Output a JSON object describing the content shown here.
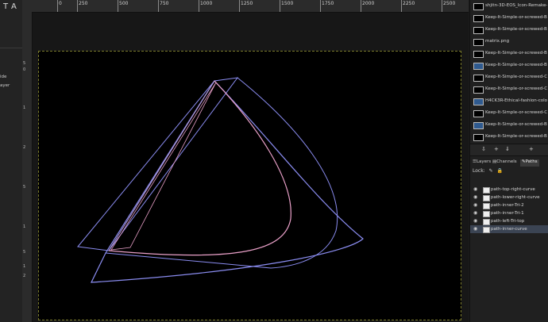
{
  "ruler": {
    "top_labels": [
      "0",
      "250",
      "500",
      "750",
      "1000",
      "1250",
      "1500",
      "1750",
      "2000",
      "2250",
      "2500"
    ],
    "left_labels": [
      "5",
      "0",
      "1",
      "2",
      "5",
      "1",
      "5",
      "1",
      "2"
    ]
  },
  "toolbox": {
    "tools": [
      "T",
      "A"
    ],
    "fragments": [
      "ide",
      "ayer"
    ]
  },
  "images": [
    {
      "name": "shjitn-3D-EOS_Icon-Remake-",
      "thumb": "dark"
    },
    {
      "name": "Keep-It-Simple-or-screwed-Bl",
      "thumb": "dark"
    },
    {
      "name": "Keep-It-Simple-or-screwed-Bl",
      "thumb": "dark"
    },
    {
      "name": "matrix.png",
      "thumb": "dark"
    },
    {
      "name": "Keep-It-Simple-or-screwed-Bl",
      "thumb": "dark"
    },
    {
      "name": "Keep-It-Simple-or-screwed-Bl",
      "thumb": "blue"
    },
    {
      "name": "Keep-It-Simple-or-screwed-Cy",
      "thumb": "dark"
    },
    {
      "name": "Keep-It-Simple-or-screwed-Cy",
      "thumb": "dark"
    },
    {
      "name": "H4CK3R-Ethical-fashion-color",
      "thumb": "blue"
    },
    {
      "name": "Keep-It-Simple-or-screwed-Cy",
      "thumb": "dark"
    },
    {
      "name": "Keep-It-Simple-or-screwed-Bl",
      "thumb": "blue"
    },
    {
      "name": "Keep-It-Simple-or-screwed-Bl",
      "thumb": "dark"
    }
  ],
  "image_buttons": [
    "⇩",
    "+",
    "⇓",
    "+"
  ],
  "tabs": {
    "layers": "Layers",
    "channels": "Channels",
    "paths": "Paths"
  },
  "lock": {
    "label": "Lock:",
    "icons": [
      "✎",
      "🔒"
    ]
  },
  "paths": [
    {
      "name": "path-top-right-curve",
      "selected": false
    },
    {
      "name": "path-lower-right-curve",
      "selected": false
    },
    {
      "name": "path-inner-Tri-2",
      "selected": false
    },
    {
      "name": "path-inner-Tri-1",
      "selected": false
    },
    {
      "name": "path-left-Tri-top",
      "selected": false
    },
    {
      "name": "path-inner-curve",
      "selected": true
    }
  ],
  "colors": {
    "path_blue": "#8a8cf0",
    "path_pink": "#e9a0c8",
    "selected_row": "#3b4453"
  }
}
